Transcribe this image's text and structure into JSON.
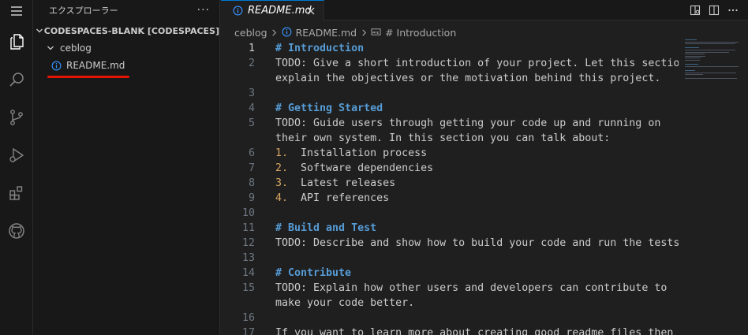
{
  "sidebar": {
    "title": "エクスプローラー",
    "more": "···",
    "workspace": "CODESPACES-BLANK [CODESPACES]",
    "folder": "ceblog",
    "file": "README.md"
  },
  "tab": {
    "label": "README.md"
  },
  "breadcrumb": {
    "folder": "ceblog",
    "file": "README.md",
    "symbol": "# Introduction"
  },
  "editor": {
    "active_line": 1,
    "lines": [
      {
        "n": "1",
        "t": "# Introduction",
        "kind": "heading"
      },
      {
        "n": "2",
        "t": "TODO: Give a short introduction of your project. Let this section",
        "kind": "text"
      },
      {
        "n": "",
        "t": "explain the objectives or the motivation behind this project.",
        "kind": "text"
      },
      {
        "n": "3",
        "t": "",
        "kind": "text"
      },
      {
        "n": "4",
        "t": "# Getting Started",
        "kind": "heading"
      },
      {
        "n": "5",
        "t": "TODO: Guide users through getting your code up and running on",
        "kind": "text"
      },
      {
        "n": "",
        "t": "their own system. In this section you can talk about:",
        "kind": "text"
      },
      {
        "n": "6",
        "num": "1.",
        "t": "  Installation process",
        "kind": "list"
      },
      {
        "n": "7",
        "num": "2.",
        "t": "  Software dependencies",
        "kind": "list"
      },
      {
        "n": "8",
        "num": "3.",
        "t": "  Latest releases",
        "kind": "list"
      },
      {
        "n": "9",
        "num": "4.",
        "t": "  API references",
        "kind": "list"
      },
      {
        "n": "10",
        "t": "",
        "kind": "text"
      },
      {
        "n": "11",
        "t": "# Build and Test",
        "kind": "heading"
      },
      {
        "n": "12",
        "t": "TODO: Describe and show how to build your code and run the tests.",
        "kind": "text"
      },
      {
        "n": "13",
        "t": "",
        "kind": "text"
      },
      {
        "n": "14",
        "t": "# Contribute",
        "kind": "heading"
      },
      {
        "n": "15",
        "t": "TODO: Explain how other users and developers can contribute to",
        "kind": "text"
      },
      {
        "n": "",
        "t": "make your code better.",
        "kind": "text"
      },
      {
        "n": "16",
        "t": "",
        "kind": "text"
      },
      {
        "n": "17",
        "t": "If you want to learn more about creating good readme files then",
        "kind": "text"
      }
    ]
  },
  "icons": {
    "activity": [
      "explorer-icon",
      "search-icon",
      "source-control-icon",
      "run-debug-icon",
      "extensions-icon",
      "github-icon"
    ],
    "file": "info-icon"
  },
  "colors": {
    "accent": "#0078d4",
    "highlight": "#e51400",
    "heading": "#569cd6",
    "list_number": "#d7a661",
    "info_icon": "#3794ff"
  }
}
